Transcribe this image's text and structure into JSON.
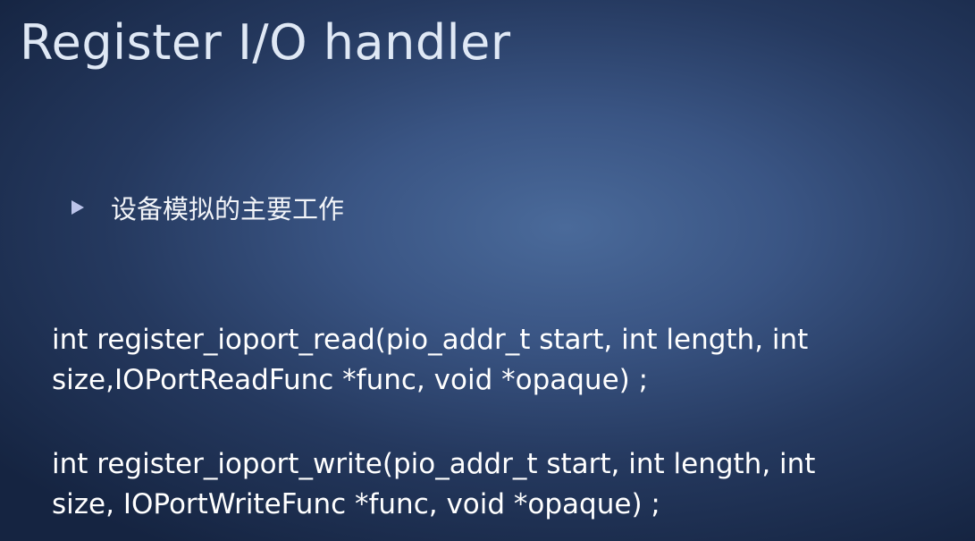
{
  "slide": {
    "title": "Register I/O handler",
    "bullet": {
      "text": "设备模拟的主要工作"
    },
    "code": [
      {
        "lines": [
          "int register_ioport_read(pio_addr_t start, int length, int",
          "size,IOPortReadFunc *func, void *opaque) ;"
        ]
      },
      {
        "lines": [
          "int register_ioport_write(pio_addr_t start, int length, int",
          "size, IOPortWriteFunc *func, void *opaque) ;"
        ]
      }
    ]
  }
}
